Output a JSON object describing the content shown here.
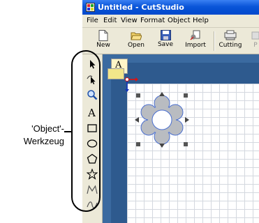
{
  "window": {
    "title": "Untitled - CutStudio"
  },
  "menu": [
    "File",
    "Edit",
    "View",
    "Format",
    "Object",
    "Help"
  ],
  "toolbar": {
    "new": "New",
    "open": "Open",
    "save": "Save",
    "import": "Import",
    "cutting": "Cutting",
    "cut_off": "P"
  },
  "toolbox": {
    "tools": [
      "select-arrow-icon",
      "node-edit-icon",
      "zoom-icon",
      "text-tool-icon",
      "rectangle-tool-icon",
      "ellipse-tool-icon",
      "polygon-tool-icon",
      "star-tool-icon",
      "polyline-tool-icon",
      "curve-tool-icon"
    ],
    "text_tool_glyph": "A"
  },
  "canvas": {
    "cursor_glyph": "A",
    "colors": {
      "workspace": "#2e5a8e",
      "grid": "#d4d8df",
      "shape_fill": "#b9bcc1",
      "shape_stroke": "#4a6fd0"
    }
  },
  "annotation": {
    "line1": "'Object'-",
    "line2": "Werkzeug"
  }
}
